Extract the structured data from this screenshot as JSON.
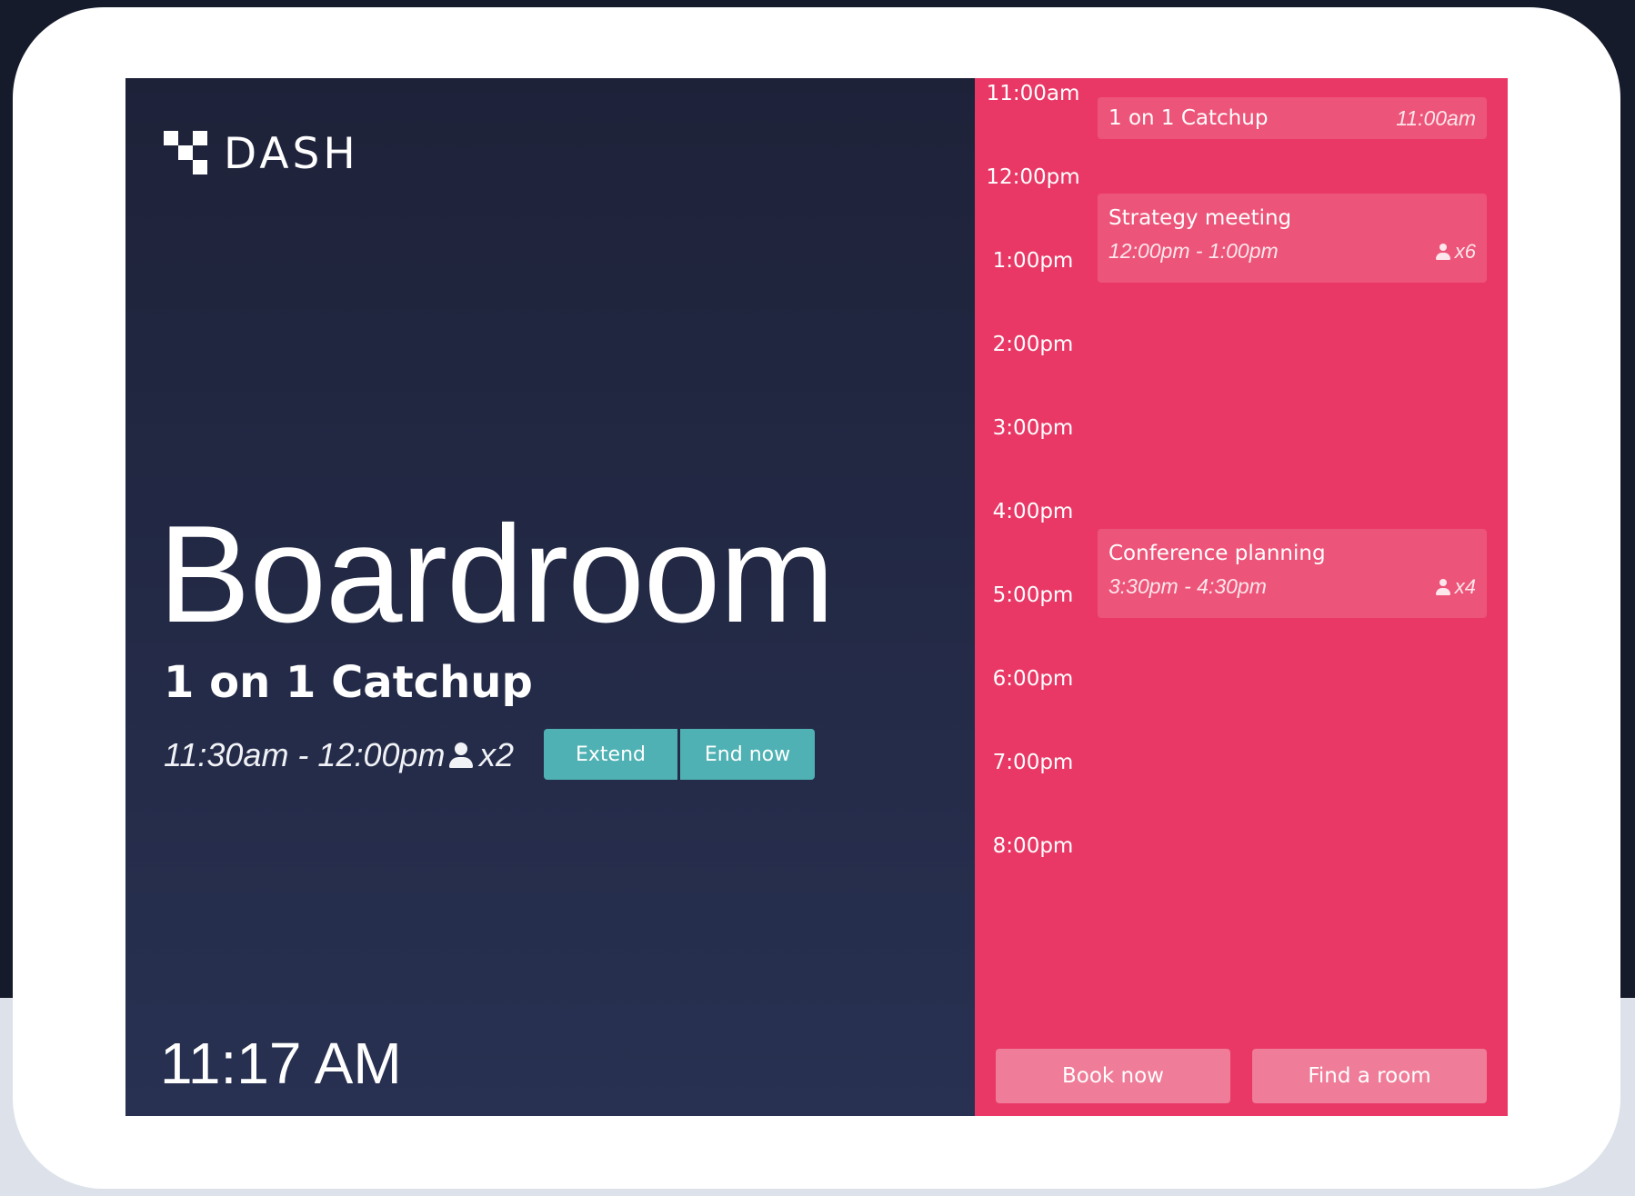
{
  "brand": {
    "name": "DASH"
  },
  "room": {
    "name": "Boardroom"
  },
  "current_meeting": {
    "title": "1 on 1 Catchup",
    "time": "11:30am - 12:00pm",
    "attendees": "x2"
  },
  "actions": {
    "extend_label": "Extend",
    "end_label": "End now"
  },
  "clock": "11:17 AM",
  "schedule": {
    "hours": [
      "11:00am",
      "12:00pm",
      "1:00pm",
      "2:00pm",
      "3:00pm",
      "4:00pm",
      "5:00pm",
      "6:00pm",
      "7:00pm",
      "8:00pm"
    ],
    "events": [
      {
        "title": "1 on 1 Catchup",
        "time": "11:00am"
      },
      {
        "title": "Strategy meeting",
        "time": "12:00pm - 1:00pm",
        "attendees": "x6"
      },
      {
        "title": "Conference planning",
        "time": "3:30pm - 4:30pm",
        "attendees": "x4"
      }
    ]
  },
  "footer": {
    "book_label": "Book now",
    "find_label": "Find a room"
  },
  "colors": {
    "left_panel_top": "#1e2239",
    "left_panel_bottom": "#283152",
    "right_panel": "#e93866",
    "event_card": "#ed5479",
    "action_button": "#4fb1b3",
    "footer_button": "#ef7c98"
  }
}
